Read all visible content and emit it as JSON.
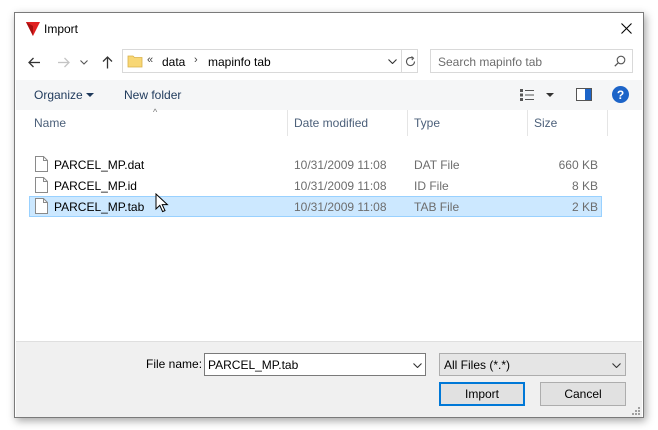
{
  "window": {
    "title": "Import",
    "accent": "#0078d7"
  },
  "navigation": {
    "back_icon": "arrow-left-icon",
    "forward_icon": "arrow-right-icon",
    "recent_icon": "chevron-down-icon",
    "up_icon": "arrow-up-icon",
    "breadcrumb": {
      "overflow": "«",
      "items": [
        "data",
        "mapinfo tab"
      ]
    },
    "search_placeholder": "Search mapinfo tab"
  },
  "toolbar": {
    "organize_label": "Organize",
    "new_folder_label": "New folder"
  },
  "columns": {
    "name": "Name",
    "date_modified": "Date modified",
    "type": "Type",
    "size": "Size"
  },
  "files": [
    {
      "name": "PARCEL_MP.dat",
      "date": "10/31/2009 11:08",
      "type": "DAT File",
      "size": "660 KB",
      "selected": false
    },
    {
      "name": "PARCEL_MP.id",
      "date": "10/31/2009 11:08",
      "type": "ID File",
      "size": "8 KB",
      "selected": false
    },
    {
      "name": "PARCEL_MP.tab",
      "date": "10/31/2009 11:08",
      "type": "TAB File",
      "size": "2 KB",
      "selected": true
    }
  ],
  "footer": {
    "file_name_label": "File name:",
    "file_name_value": "PARCEL_MP.tab",
    "filter_value": "All Files (*.*)",
    "import_label": "Import",
    "cancel_label": "Cancel"
  }
}
